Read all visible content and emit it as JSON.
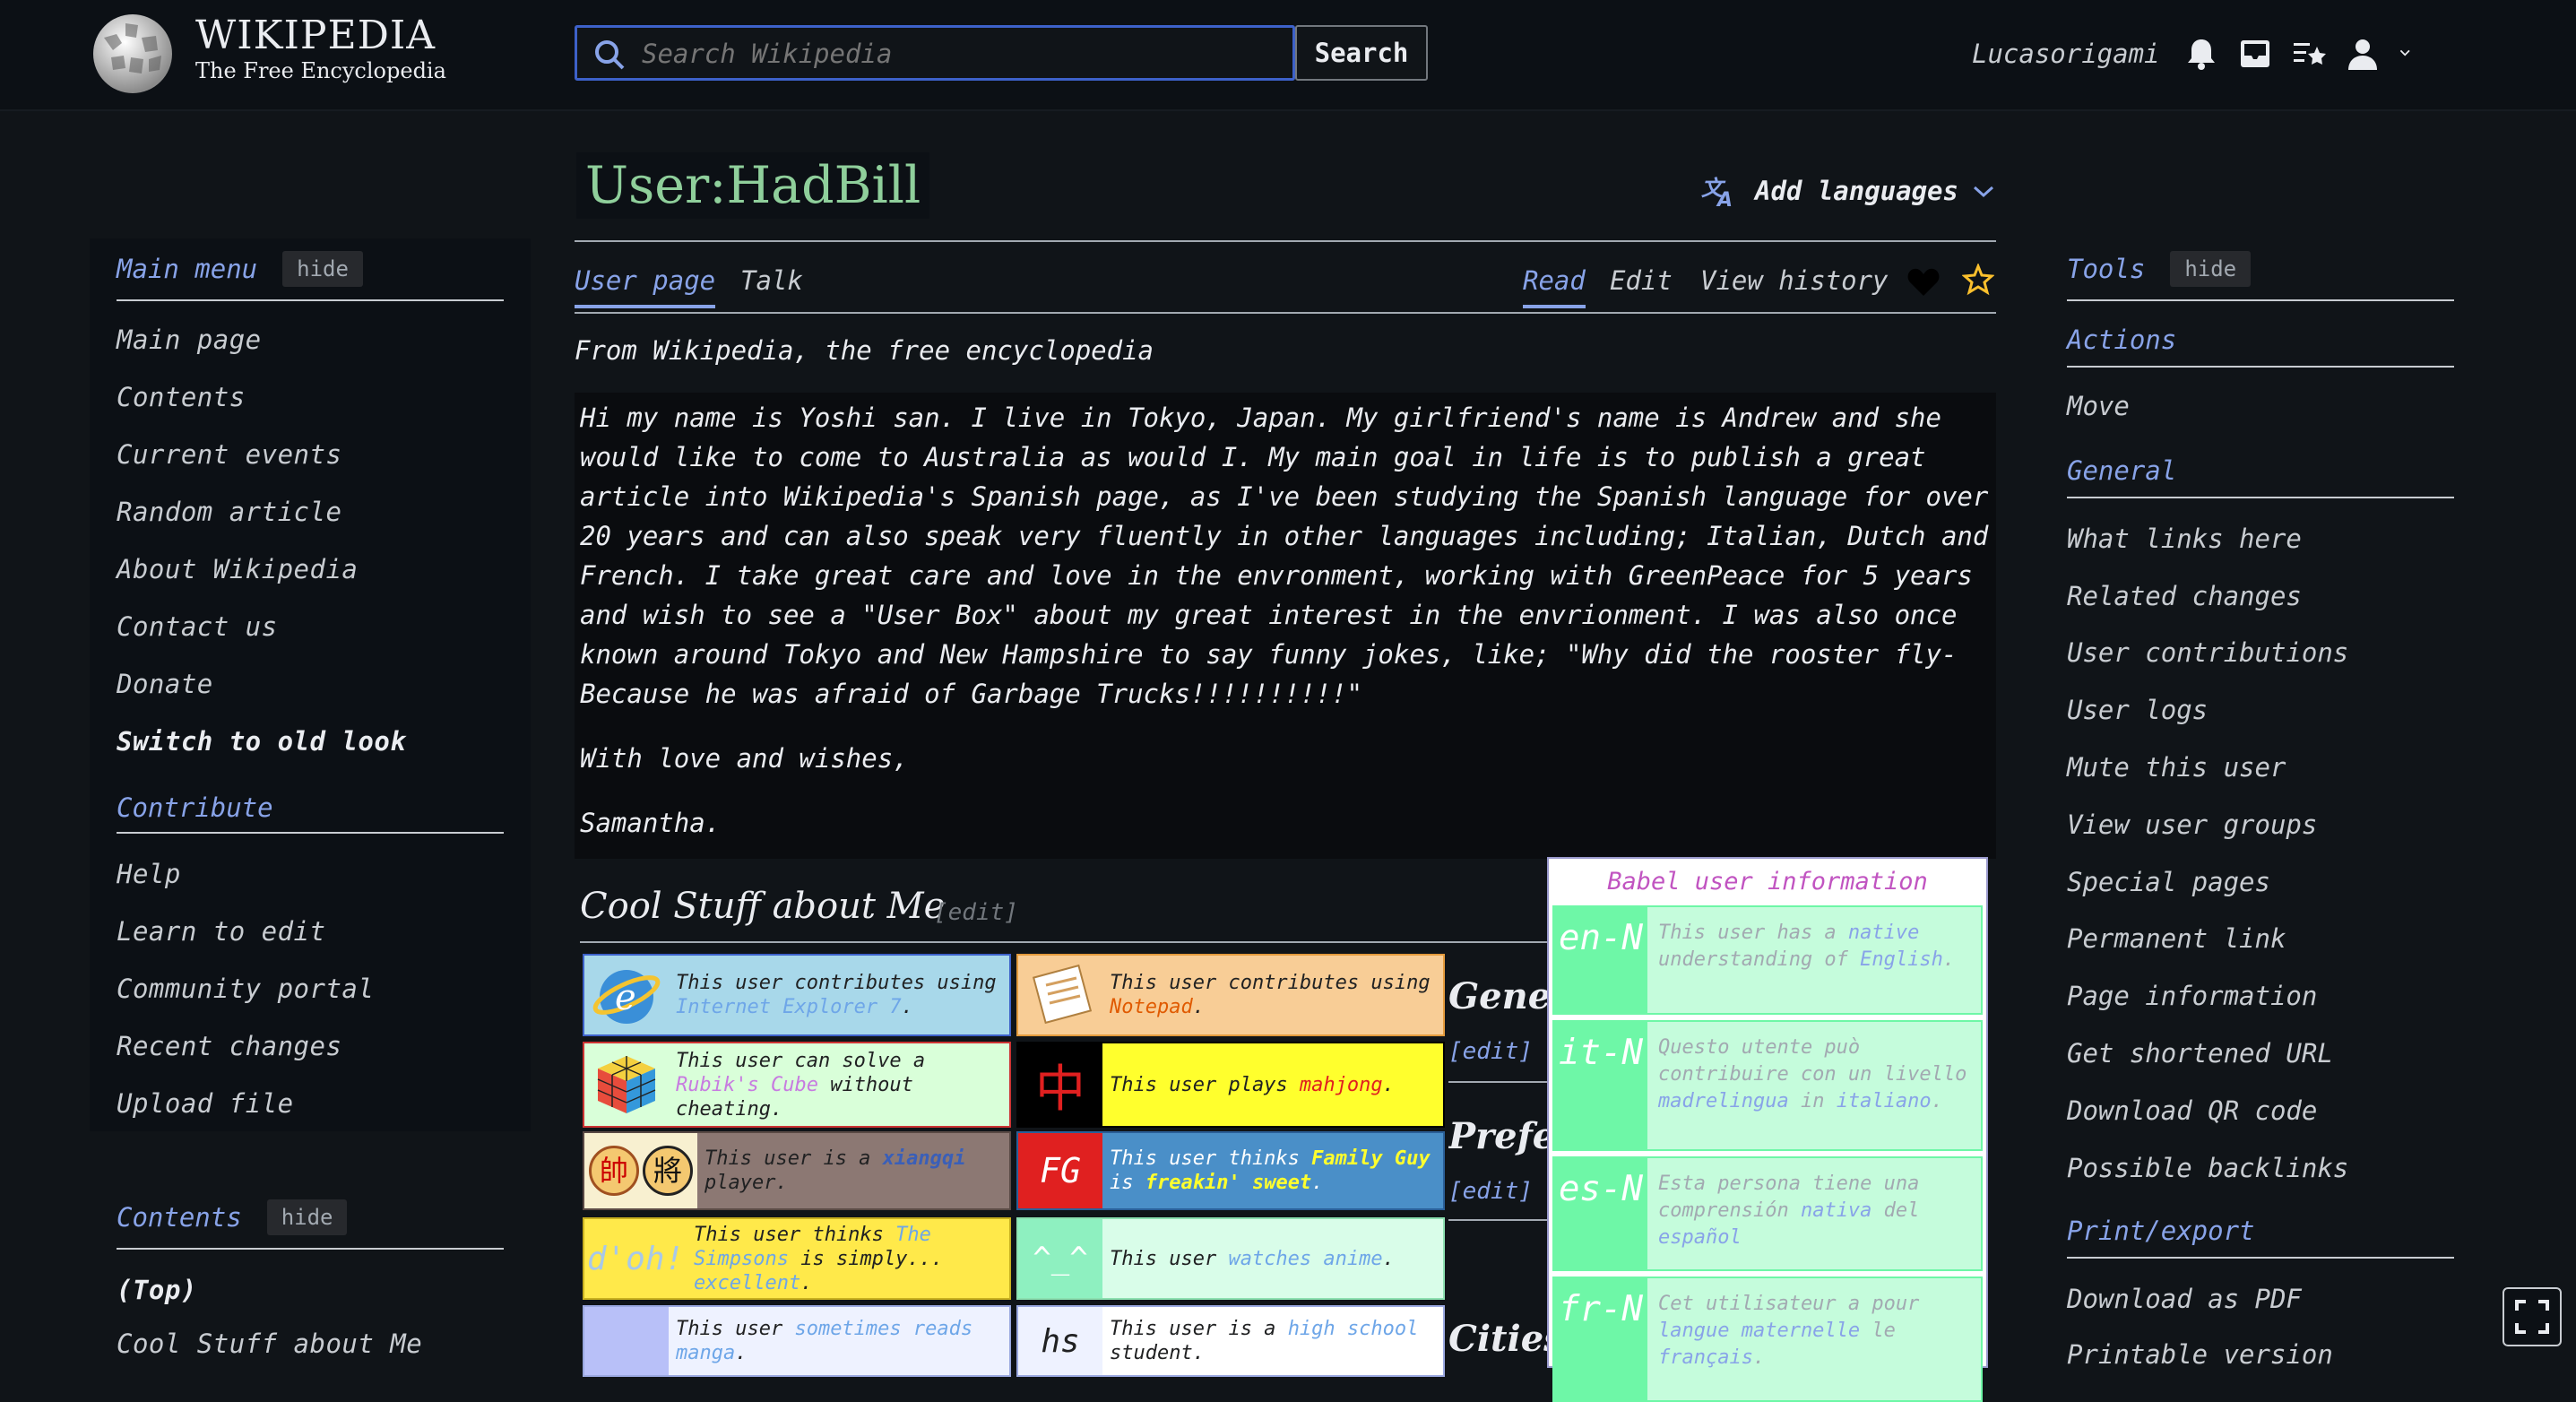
{
  "header": {
    "wordmark_title": "WIKIPEDIA",
    "wordmark_tagline": "The Free Encyclopedia",
    "search_placeholder": "Search Wikipedia",
    "search_button": "Search",
    "username": "Lucasorigami",
    "icons": [
      "wikipedia-globe-logo",
      "search-icon",
      "bell-icon",
      "inbox-icon",
      "watchlist-icon",
      "user-icon",
      "chevron-down-icon"
    ]
  },
  "main_menu": {
    "title": "Main menu",
    "hide": "hide",
    "items": [
      "Main page",
      "Contents",
      "Current events",
      "Random article",
      "About Wikipedia",
      "Contact us",
      "Donate"
    ],
    "switch_look": "Switch to old look",
    "contribute_title": "Contribute",
    "contribute_items": [
      "Help",
      "Learn to edit",
      "Community portal",
      "Recent changes",
      "Upload file"
    ]
  },
  "toc": {
    "title": "Contents",
    "hide": "hide",
    "items": [
      "(Top)",
      "Cool Stuff about Me"
    ]
  },
  "page": {
    "title": "User:HadBill",
    "add_languages": "Add languages",
    "tabs_left": [
      "User page",
      "Talk"
    ],
    "tabs_right": [
      "Read",
      "Edit",
      "View history"
    ],
    "tagline": "From Wikipedia, the free encyclopedia",
    "bio_paragraphs": [
      "Hi my name is Yoshi san. I live in Tokyo, Japan. My girlfriend's name is Andrew and she would like to come to Australia as would I. My main goal in life is to publish a great article into Wikipedia's Spanish page, as I've been studying the Spanish language for over 20 years and can also speak very fluently in other languages including; Italian, Dutch and French. I take great care and love in the envronment, working with GreenPeace for 5 years and wish to see a \"User Box\" about my great interest in the envrionment. I was also once known around Tokyo and New Hampshire to say funny jokes, like; \"Why did the rooster fly- Because he was afraid of Garbage Trucks!!!!!!!!!!\"",
      "With love and wishes,",
      "Samantha."
    ],
    "section_title": "Cool Stuff about Me",
    "section_edit": "[edit]",
    "side_headings": [
      "Gener",
      "Prefe",
      "Cities"
    ],
    "side_edit": "[edit]"
  },
  "userboxes": [
    {
      "icon": "internet-explorer-icon",
      "pre": "This user contributes using ",
      "link": "Internet Explorer 7",
      "post": "."
    },
    {
      "icon": "notepad-icon",
      "pre": "This user contributes using ",
      "link": "Notepad",
      "post": "."
    },
    {
      "icon": "rubiks-cube-icon",
      "pre": "This user can solve a ",
      "link": "Rubik's Cube",
      "post": " without cheating."
    },
    {
      "icon_text": "中",
      "pre": "This user plays ",
      "link": "mahjong",
      "post": "."
    },
    {
      "icon": "xiangqi-pieces-icon",
      "icon_text_a": "帥",
      "icon_text_b": "將",
      "pre": "This user is a ",
      "link": "xiangqi",
      "post": " player."
    },
    {
      "icon_text": "FG",
      "pre": "This user thinks ",
      "link": "Family Guy",
      "mid": " is ",
      "link2": "freakin' sweet",
      "post": "."
    },
    {
      "icon_text": "d'oh!",
      "pre": "This user thinks ",
      "link": "The Simpsons",
      "post": " is simply... ",
      "link2": "excellent",
      "post2": "."
    },
    {
      "icon_text": "^_^",
      "pre": "This user ",
      "link": "watches anime",
      "post": "."
    },
    {
      "pre": "This user ",
      "link": "sometimes reads manga",
      "post": "."
    },
    {
      "icon_text": "hs",
      "pre": "This user is a ",
      "link": "high school",
      "post": " student."
    }
  ],
  "babel": {
    "title": "Babel user information",
    "entries": [
      {
        "code": "en-N",
        "pre": "This user has a ",
        "link": "native",
        "mid": " understanding of ",
        "link2": "English",
        "post": "."
      },
      {
        "code": "it-N",
        "pre": "Questo utente può contribuire con un livello ",
        "link": "madrelingua",
        "mid": " in ",
        "link2": "italiano",
        "post": "."
      },
      {
        "code": "es-N",
        "pre": "Esta persona tiene una comprensión ",
        "link": "nativa",
        "mid": " del ",
        "link2": "español",
        "post": ""
      },
      {
        "code": "fr-N",
        "pre": "Cet utilisateur a pour ",
        "link": "langue maternelle",
        "mid": " le ",
        "link2": "français",
        "post": "."
      }
    ]
  },
  "tools": {
    "title": "Tools",
    "hide": "hide",
    "actions_title": "Actions",
    "actions": [
      "Move"
    ],
    "general_title": "General",
    "general": [
      "What links here",
      "Related changes",
      "User contributions",
      "User logs",
      "Mute this user",
      "View user groups",
      "Special pages",
      "Permanent link",
      "Page information",
      "Get shortened URL",
      "Download QR code",
      "Possible backlinks"
    ],
    "print_title": "Print/export",
    "print": [
      "Download as PDF",
      "Printable version"
    ]
  },
  "colors": {
    "accent": "#88a3e8",
    "title_green": "#8fcf9b",
    "background": "#101418"
  }
}
